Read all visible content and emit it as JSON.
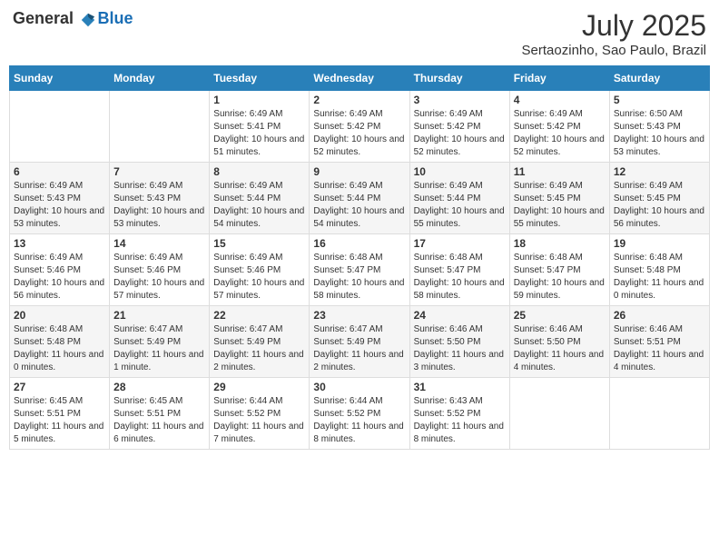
{
  "header": {
    "logo_general": "General",
    "logo_blue": "Blue",
    "month_year": "July 2025",
    "location": "Sertaozinho, Sao Paulo, Brazil"
  },
  "days_of_week": [
    "Sunday",
    "Monday",
    "Tuesday",
    "Wednesday",
    "Thursday",
    "Friday",
    "Saturday"
  ],
  "weeks": [
    [
      {
        "day": "",
        "info": ""
      },
      {
        "day": "",
        "info": ""
      },
      {
        "day": "1",
        "info": "Sunrise: 6:49 AM\nSunset: 5:41 PM\nDaylight: 10 hours and 51 minutes."
      },
      {
        "day": "2",
        "info": "Sunrise: 6:49 AM\nSunset: 5:42 PM\nDaylight: 10 hours and 52 minutes."
      },
      {
        "day": "3",
        "info": "Sunrise: 6:49 AM\nSunset: 5:42 PM\nDaylight: 10 hours and 52 minutes."
      },
      {
        "day": "4",
        "info": "Sunrise: 6:49 AM\nSunset: 5:42 PM\nDaylight: 10 hours and 52 minutes."
      },
      {
        "day": "5",
        "info": "Sunrise: 6:50 AM\nSunset: 5:43 PM\nDaylight: 10 hours and 53 minutes."
      }
    ],
    [
      {
        "day": "6",
        "info": "Sunrise: 6:49 AM\nSunset: 5:43 PM\nDaylight: 10 hours and 53 minutes."
      },
      {
        "day": "7",
        "info": "Sunrise: 6:49 AM\nSunset: 5:43 PM\nDaylight: 10 hours and 53 minutes."
      },
      {
        "day": "8",
        "info": "Sunrise: 6:49 AM\nSunset: 5:44 PM\nDaylight: 10 hours and 54 minutes."
      },
      {
        "day": "9",
        "info": "Sunrise: 6:49 AM\nSunset: 5:44 PM\nDaylight: 10 hours and 54 minutes."
      },
      {
        "day": "10",
        "info": "Sunrise: 6:49 AM\nSunset: 5:44 PM\nDaylight: 10 hours and 55 minutes."
      },
      {
        "day": "11",
        "info": "Sunrise: 6:49 AM\nSunset: 5:45 PM\nDaylight: 10 hours and 55 minutes."
      },
      {
        "day": "12",
        "info": "Sunrise: 6:49 AM\nSunset: 5:45 PM\nDaylight: 10 hours and 56 minutes."
      }
    ],
    [
      {
        "day": "13",
        "info": "Sunrise: 6:49 AM\nSunset: 5:46 PM\nDaylight: 10 hours and 56 minutes."
      },
      {
        "day": "14",
        "info": "Sunrise: 6:49 AM\nSunset: 5:46 PM\nDaylight: 10 hours and 57 minutes."
      },
      {
        "day": "15",
        "info": "Sunrise: 6:49 AM\nSunset: 5:46 PM\nDaylight: 10 hours and 57 minutes."
      },
      {
        "day": "16",
        "info": "Sunrise: 6:48 AM\nSunset: 5:47 PM\nDaylight: 10 hours and 58 minutes."
      },
      {
        "day": "17",
        "info": "Sunrise: 6:48 AM\nSunset: 5:47 PM\nDaylight: 10 hours and 58 minutes."
      },
      {
        "day": "18",
        "info": "Sunrise: 6:48 AM\nSunset: 5:47 PM\nDaylight: 10 hours and 59 minutes."
      },
      {
        "day": "19",
        "info": "Sunrise: 6:48 AM\nSunset: 5:48 PM\nDaylight: 11 hours and 0 minutes."
      }
    ],
    [
      {
        "day": "20",
        "info": "Sunrise: 6:48 AM\nSunset: 5:48 PM\nDaylight: 11 hours and 0 minutes."
      },
      {
        "day": "21",
        "info": "Sunrise: 6:47 AM\nSunset: 5:49 PM\nDaylight: 11 hours and 1 minute."
      },
      {
        "day": "22",
        "info": "Sunrise: 6:47 AM\nSunset: 5:49 PM\nDaylight: 11 hours and 2 minutes."
      },
      {
        "day": "23",
        "info": "Sunrise: 6:47 AM\nSunset: 5:49 PM\nDaylight: 11 hours and 2 minutes."
      },
      {
        "day": "24",
        "info": "Sunrise: 6:46 AM\nSunset: 5:50 PM\nDaylight: 11 hours and 3 minutes."
      },
      {
        "day": "25",
        "info": "Sunrise: 6:46 AM\nSunset: 5:50 PM\nDaylight: 11 hours and 4 minutes."
      },
      {
        "day": "26",
        "info": "Sunrise: 6:46 AM\nSunset: 5:51 PM\nDaylight: 11 hours and 4 minutes."
      }
    ],
    [
      {
        "day": "27",
        "info": "Sunrise: 6:45 AM\nSunset: 5:51 PM\nDaylight: 11 hours and 5 minutes."
      },
      {
        "day": "28",
        "info": "Sunrise: 6:45 AM\nSunset: 5:51 PM\nDaylight: 11 hours and 6 minutes."
      },
      {
        "day": "29",
        "info": "Sunrise: 6:44 AM\nSunset: 5:52 PM\nDaylight: 11 hours and 7 minutes."
      },
      {
        "day": "30",
        "info": "Sunrise: 6:44 AM\nSunset: 5:52 PM\nDaylight: 11 hours and 8 minutes."
      },
      {
        "day": "31",
        "info": "Sunrise: 6:43 AM\nSunset: 5:52 PM\nDaylight: 11 hours and 8 minutes."
      },
      {
        "day": "",
        "info": ""
      },
      {
        "day": "",
        "info": ""
      }
    ]
  ]
}
